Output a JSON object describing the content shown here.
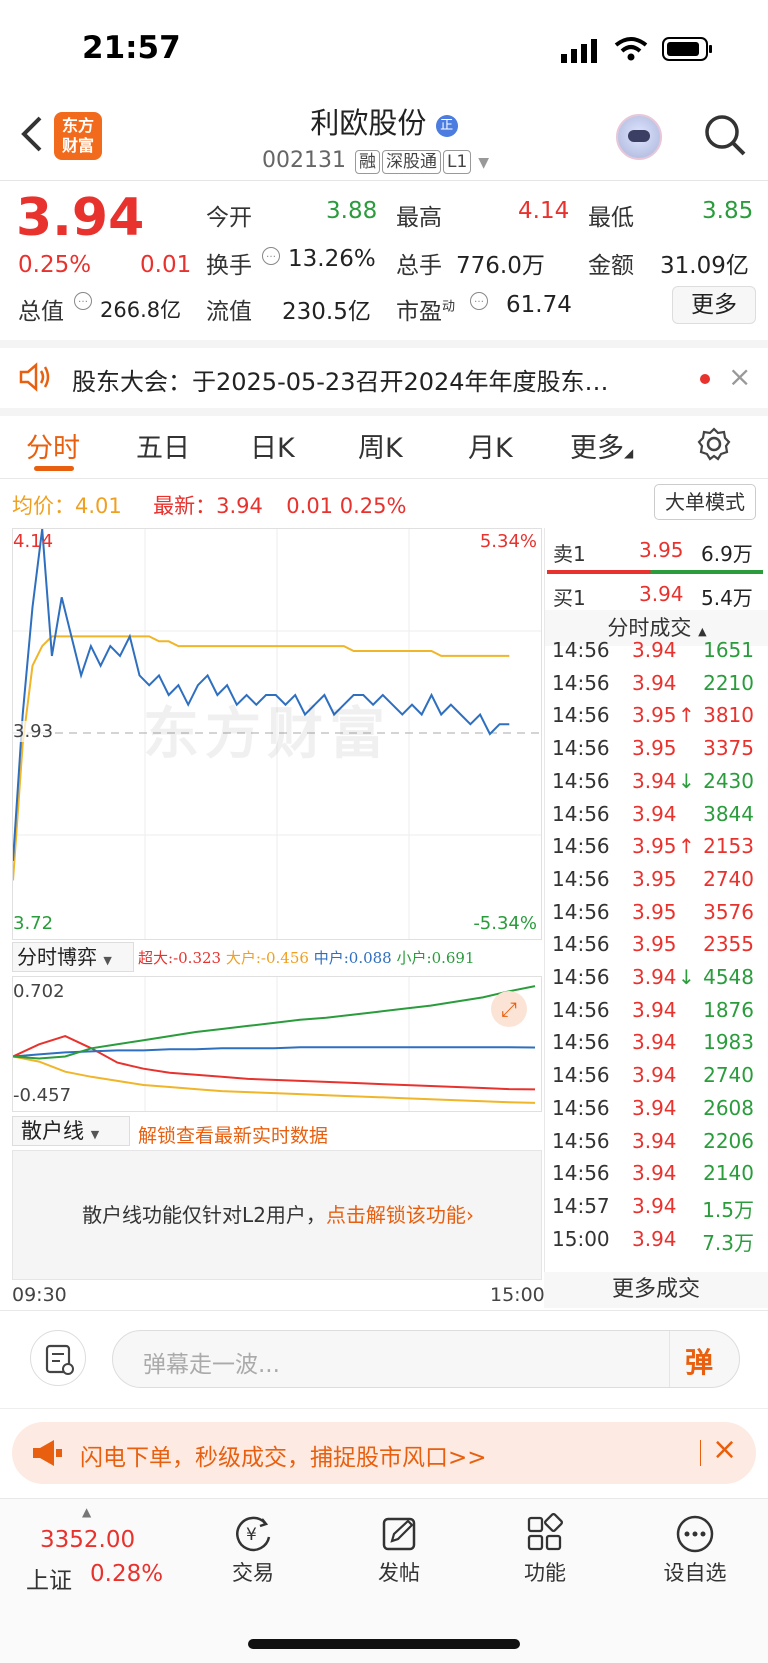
{
  "status_bar": {
    "time": "21:57"
  },
  "header": {
    "name": "利欧股份",
    "name_badge": "正",
    "code": "002131",
    "tags": [
      "融",
      "深股通",
      "L1"
    ],
    "back_icon": "chevron-left-icon",
    "logo_text_line1": "东方",
    "logo_text_line2": "财富",
    "search_icon": "search-icon"
  },
  "quote": {
    "price": "3.94",
    "change_pct": "0.25%",
    "change": "0.01",
    "fields": [
      {
        "label": "今开",
        "value": "3.88",
        "color": "#2a9c3c"
      },
      {
        "label": "最高",
        "value": "4.14",
        "color": "#e8322e"
      },
      {
        "label": "最低",
        "value": "3.85",
        "color": "#2a9c3c"
      },
      {
        "label": "换手",
        "value": "13.26%",
        "color": "#222"
      },
      {
        "label": "总手",
        "value": "776.0万",
        "color": "#222"
      },
      {
        "label": "金额",
        "value": "31.09亿",
        "color": "#222"
      },
      {
        "label": "总值",
        "value": "266.8亿",
        "color": "#222"
      },
      {
        "label": "流值",
        "value": "230.5亿",
        "color": "#222"
      },
      {
        "label": "市盈",
        "label_sup": "动",
        "value": "61.74",
        "color": "#222"
      }
    ],
    "more_button": "更多"
  },
  "notice": {
    "text": "股东大会：于2025-05-23召开2024年年度股东…"
  },
  "tabs": {
    "items": [
      "分时",
      "五日",
      "日K",
      "周K",
      "月K",
      "更多"
    ],
    "active": 0
  },
  "price_info": {
    "avg_label": "均价：",
    "avg_value": "4.01",
    "latest_label": "最新：",
    "latest_value": "3.94",
    "change": "0.01",
    "change_pct": "0.25%",
    "mode_button": "大单模式"
  },
  "main_chart": {
    "y_top": "4.14",
    "y_mid": "3.93",
    "y_bottom": "3.72",
    "pct_top": "5.34%",
    "pct_bottom": "-5.34%",
    "watermark": "东方财富",
    "x_start": "09:30",
    "x_end": "15:00"
  },
  "chart_data": {
    "type": "line",
    "title": "",
    "ylim": [
      3.72,
      4.14
    ],
    "series": [
      {
        "name": "最新",
        "color": "#2f6fbf",
        "values": [
          3.8,
          3.95,
          4.06,
          4.14,
          4.01,
          4.07,
          4.03,
          3.99,
          4.02,
          4.0,
          4.02,
          4.01,
          4.03,
          3.99,
          3.98,
          3.99,
          3.97,
          3.98,
          3.96,
          3.98,
          3.99,
          3.97,
          3.98,
          3.96,
          3.97,
          3.96,
          3.97,
          3.97,
          3.96,
          3.97,
          3.95,
          3.96,
          3.97,
          3.95,
          3.96,
          3.97,
          3.97,
          3.96,
          3.97,
          3.96,
          3.95,
          3.96,
          3.95,
          3.97,
          3.95,
          3.96,
          3.95,
          3.94,
          3.95,
          3.93,
          3.94,
          3.94
        ]
      },
      {
        "name": "均价",
        "color": "#f0b528",
        "values": [
          3.78,
          3.92,
          4.0,
          4.02,
          4.03,
          4.03,
          4.03,
          4.03,
          4.03,
          4.03,
          4.03,
          4.03,
          4.03,
          4.03,
          4.03,
          4.025,
          4.025,
          4.02,
          4.02,
          4.02,
          4.02,
          4.02,
          4.02,
          4.02,
          4.02,
          4.02,
          4.02,
          4.02,
          4.02,
          4.02,
          4.02,
          4.02,
          4.02,
          4.02,
          4.02,
          4.015,
          4.015,
          4.015,
          4.015,
          4.015,
          4.015,
          4.015,
          4.015,
          4.015,
          4.01,
          4.01,
          4.01,
          4.01,
          4.01,
          4.01,
          4.01,
          4.01
        ]
      }
    ]
  },
  "sub_chart": {
    "title": "分时博弈",
    "legend": [
      {
        "label": "超大:",
        "value": "-0.323",
        "color": "#e8322e"
      },
      {
        "label": "大户:",
        "value": "-0.456",
        "color": "#f0b528"
      },
      {
        "label": "中户:",
        "value": "0.088",
        "color": "#2f6fbf"
      },
      {
        "label": "小户:",
        "value": "0.691",
        "color": "#2a9c3c"
      }
    ],
    "y_top": "0.702",
    "y_bottom": "-0.457",
    "series": [
      {
        "color": "#e8322e",
        "values": [
          0,
          0.12,
          0.2,
          0.08,
          -0.06,
          -0.12,
          -0.16,
          -0.18,
          -0.2,
          -0.22,
          -0.23,
          -0.24,
          -0.25,
          -0.26,
          -0.27,
          -0.28,
          -0.29,
          -0.3,
          -0.31,
          -0.32,
          -0.323
        ]
      },
      {
        "color": "#f0b528",
        "values": [
          0,
          -0.05,
          -0.15,
          -0.2,
          -0.24,
          -0.28,
          -0.3,
          -0.32,
          -0.34,
          -0.35,
          -0.36,
          -0.37,
          -0.38,
          -0.39,
          -0.4,
          -0.41,
          -0.42,
          -0.43,
          -0.44,
          -0.45,
          -0.456
        ]
      },
      {
        "color": "#2f6fbf",
        "values": [
          0,
          0.02,
          0.04,
          0.05,
          0.06,
          0.06,
          0.07,
          0.07,
          0.08,
          0.08,
          0.08,
          0.09,
          0.09,
          0.09,
          0.09,
          0.09,
          0.09,
          0.09,
          0.09,
          0.09,
          0.088
        ]
      },
      {
        "color": "#2a9c3c",
        "values": [
          0,
          -0.02,
          0.0,
          0.08,
          0.12,
          0.16,
          0.2,
          0.24,
          0.27,
          0.3,
          0.33,
          0.36,
          0.38,
          0.41,
          0.44,
          0.47,
          0.5,
          0.54,
          0.58,
          0.64,
          0.691
        ]
      }
    ]
  },
  "retail_line": {
    "title": "散户线",
    "unlock_tip": "解锁查看最新实时数据",
    "locked_text": "散户线功能仅针对L2用户，",
    "unlock_link": "点击解锁该功能"
  },
  "order_book": {
    "sell_label": "卖1",
    "sell_price": "3.95",
    "sell_vol": "6.9万",
    "buy_label": "买1",
    "buy_price": "3.94",
    "buy_vol": "5.4万",
    "ticks_title": "分时成交",
    "more": "更多成交"
  },
  "ticks": [
    {
      "time": "14:56",
      "price": "3.94",
      "arrow": "",
      "vol": "1651",
      "pc": "#e8322e",
      "vc": "#2a9c3c"
    },
    {
      "time": "14:56",
      "price": "3.94",
      "arrow": "",
      "vol": "2210",
      "pc": "#e8322e",
      "vc": "#2a9c3c"
    },
    {
      "time": "14:56",
      "price": "3.95",
      "arrow": "↑",
      "vol": "3810",
      "pc": "#e8322e",
      "vc": "#e8322e"
    },
    {
      "time": "14:56",
      "price": "3.95",
      "arrow": "",
      "vol": "3375",
      "pc": "#e8322e",
      "vc": "#e8322e"
    },
    {
      "time": "14:56",
      "price": "3.94",
      "arrow": "↓",
      "vol": "2430",
      "pc": "#e8322e",
      "vc": "#2a9c3c"
    },
    {
      "time": "14:56",
      "price": "3.94",
      "arrow": "",
      "vol": "3844",
      "pc": "#e8322e",
      "vc": "#2a9c3c"
    },
    {
      "time": "14:56",
      "price": "3.95",
      "arrow": "↑",
      "vol": "2153",
      "pc": "#e8322e",
      "vc": "#e8322e"
    },
    {
      "time": "14:56",
      "price": "3.95",
      "arrow": "",
      "vol": "2740",
      "pc": "#e8322e",
      "vc": "#e8322e"
    },
    {
      "time": "14:56",
      "price": "3.95",
      "arrow": "",
      "vol": "3576",
      "pc": "#e8322e",
      "vc": "#e8322e"
    },
    {
      "time": "14:56",
      "price": "3.95",
      "arrow": "",
      "vol": "2355",
      "pc": "#e8322e",
      "vc": "#e8322e"
    },
    {
      "time": "14:56",
      "price": "3.94",
      "arrow": "↓",
      "vol": "4548",
      "pc": "#e8322e",
      "vc": "#2a9c3c"
    },
    {
      "time": "14:56",
      "price": "3.94",
      "arrow": "",
      "vol": "1876",
      "pc": "#e8322e",
      "vc": "#2a9c3c"
    },
    {
      "time": "14:56",
      "price": "3.94",
      "arrow": "",
      "vol": "1983",
      "pc": "#e8322e",
      "vc": "#2a9c3c"
    },
    {
      "time": "14:56",
      "price": "3.94",
      "arrow": "",
      "vol": "2740",
      "pc": "#e8322e",
      "vc": "#2a9c3c"
    },
    {
      "time": "14:56",
      "price": "3.94",
      "arrow": "",
      "vol": "2608",
      "pc": "#e8322e",
      "vc": "#2a9c3c"
    },
    {
      "time": "14:56",
      "price": "3.94",
      "arrow": "",
      "vol": "2206",
      "pc": "#e8322e",
      "vc": "#2a9c3c"
    },
    {
      "time": "14:56",
      "price": "3.94",
      "arrow": "",
      "vol": "2140",
      "pc": "#e8322e",
      "vc": "#2a9c3c"
    },
    {
      "time": "14:57",
      "price": "3.94",
      "arrow": "",
      "vol": "1.5万",
      "pc": "#e8322e",
      "vc": "#2a9c3c"
    },
    {
      "time": "15:00",
      "price": "3.94",
      "arrow": "",
      "vol": "7.3万",
      "pc": "#e8322e",
      "vc": "#2a9c3c"
    }
  ],
  "danmaku": {
    "placeholder": "弹幕走一波...",
    "button": "弹"
  },
  "promo": {
    "text": "闪电下单，秒级成交，捕捉股市风口>>"
  },
  "bottom_nav": {
    "index_value": "3352.00",
    "index_name": "上证",
    "index_change": "0.28%",
    "items": [
      {
        "label": "交易",
        "icon": "yen-cycle-icon"
      },
      {
        "label": "发帖",
        "icon": "edit-icon"
      },
      {
        "label": "功能",
        "icon": "grid-icon"
      },
      {
        "label": "设自选",
        "icon": "more-icon"
      }
    ]
  }
}
